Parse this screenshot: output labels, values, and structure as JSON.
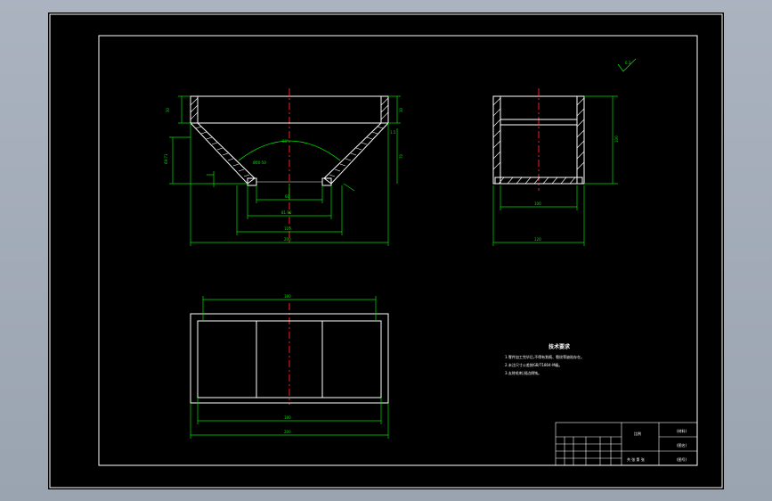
{
  "drawing": {
    "colors": {
      "viewport_bg": "#000000",
      "frame": "#ffffff",
      "dimension": "#00e000",
      "centerline": "#ff2020",
      "hatch": "#ffffff"
    },
    "front_view": {
      "dim_overall_width": "200",
      "dim_bottom_outer": "110",
      "dim_bottom_mid": "81.96",
      "dim_bottom_inner": "60",
      "dim_left_top": "30",
      "dim_left_side": "69.71",
      "dim_right_top": "30",
      "dim_right_mid": "70",
      "dim_chamfer": "1.5",
      "arc_label": "60°",
      "arc_label2": "Ø40-50"
    },
    "side_view": {
      "dim_width": "120",
      "dim_inner": "100",
      "dim_height": "100"
    },
    "plan_view": {
      "dim_top": "180",
      "dim_bottom_inner": "180",
      "dim_bottom_outer": "200"
    },
    "roughness": "6.3",
    "notes": {
      "title": "技术要求",
      "lines": [
        "1.零件加工完毕后,不得有划痕、裂纹等缺陷存在。",
        "2.未注尺寸公差按GB/T1804-M级。",
        "3.去除毛刺,锐边倒钝。"
      ]
    },
    "title_block": {
      "material": "(材料)",
      "part_name": "(图名)",
      "drawing_no": "(图号)",
      "scale_label": "比例",
      "sheet_label": "共 张 第 张"
    }
  }
}
